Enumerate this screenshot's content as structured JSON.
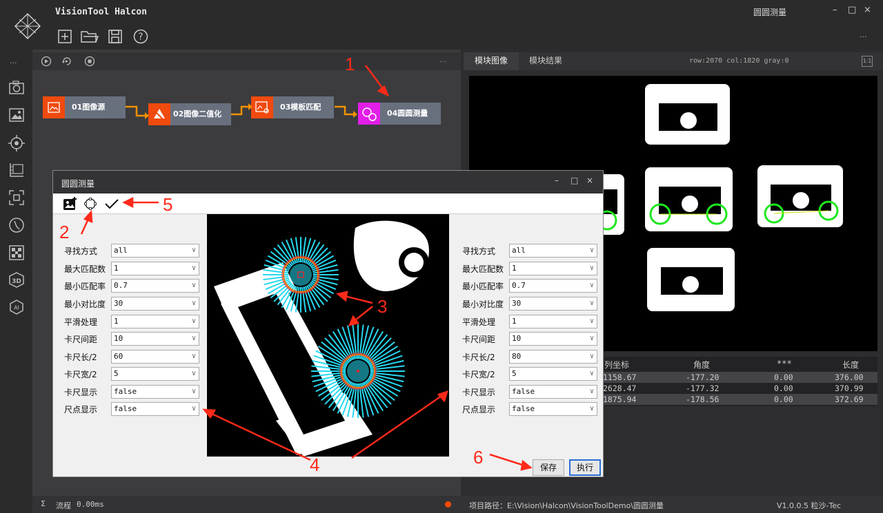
{
  "app": {
    "title": "VisionTool Halcon",
    "caption": "圆圆测量"
  },
  "window_controls": {
    "minimize": "–",
    "maximize": "□",
    "close": "×"
  },
  "toolbar_icons": [
    "new-file-icon",
    "open-folder-icon",
    "save-icon",
    "help-icon"
  ],
  "more": "...",
  "flow": {
    "nodes": [
      {
        "label": "01图像源"
      },
      {
        "label": "02图像二值化"
      },
      {
        "label": "03模板匹配"
      },
      {
        "label": "04圆圆测量"
      }
    ]
  },
  "right": {
    "tabs": [
      "模块图像",
      "模块结果"
    ],
    "pixel_info": "row:2070 col:1820 gray:0",
    "fit": "1:1",
    "table": {
      "headers": [
        "列坐标",
        "角度",
        "***",
        "长度"
      ],
      "rows": [
        [
          "1158.67",
          "-177.20",
          "0.00",
          "376.00"
        ],
        [
          "2628.47",
          "-177.32",
          "0.00",
          "370.99"
        ],
        [
          "1875.94",
          "-178.56",
          "0.00",
          "372.69"
        ]
      ]
    }
  },
  "status": {
    "sigma": "Σ",
    "flow_label": "流程",
    "flow_time": "0.00ms",
    "path": "项目路径：E:\\Vision\\Halcon\\VisionToolDemo\\圆圆测量",
    "version": "V1.0.0.5 粒沙-Tec"
  },
  "dialog": {
    "title": "圆圆测量",
    "left_params": [
      {
        "label": "寻找方式",
        "value": "all"
      },
      {
        "label": "最大匹配数",
        "value": "1"
      },
      {
        "label": "最小匹配率",
        "value": "0.7"
      },
      {
        "label": "最小对比度",
        "value": "30"
      },
      {
        "label": "平滑处理",
        "value": "1"
      },
      {
        "label": "卡尺间距",
        "value": "10"
      },
      {
        "label": "卡尺长/2",
        "value": "60"
      },
      {
        "label": "卡尺宽/2",
        "value": "5"
      },
      {
        "label": "卡尺显示",
        "value": "false"
      },
      {
        "label": "尺点显示",
        "value": "false"
      }
    ],
    "right_params": [
      {
        "label": "寻找方式",
        "value": "all"
      },
      {
        "label": "最大匹配数",
        "value": "1"
      },
      {
        "label": "最小匹配率",
        "value": "0.7"
      },
      {
        "label": "最小对比度",
        "value": "30"
      },
      {
        "label": "平滑处理",
        "value": "1"
      },
      {
        "label": "卡尺间距",
        "value": "10"
      },
      {
        "label": "卡尺长/2",
        "value": "80"
      },
      {
        "label": "卡尺宽/2",
        "value": "5"
      },
      {
        "label": "卡尺显示",
        "value": "false"
      },
      {
        "label": "尺点显示",
        "value": "false"
      }
    ],
    "save": "保存",
    "run": "执行"
  },
  "annotations": [
    "1",
    "2",
    "3",
    "4",
    "5",
    "6"
  ],
  "colors": {
    "node_orange": "#f04a0f",
    "node_magenta": "#e21ee8",
    "arrow": "#f39200",
    "anno_red": "#ff2a1a",
    "circle_green": "#1ee81e",
    "caliper_cyan": "#27d9f0"
  }
}
